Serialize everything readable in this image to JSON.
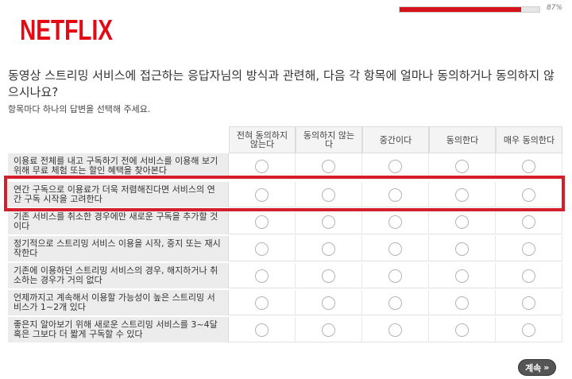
{
  "brand": {
    "logo_text": "NETFLIX",
    "color": "#e50914"
  },
  "progress": {
    "percent_label": "87%",
    "value": 87
  },
  "survey": {
    "question": "동영상 스트리밍 서비스에 접근하는 응답자님의 방식과 관련해, 다음 각 항목에 얼마나 동의하거나 동의하지 않으시나요?",
    "instruction": "항목마다 하나의 답변을 선택해 주세요.",
    "columns": [
      "전혀 동의하지 않는다",
      "동의하지 않는다",
      "중간이다",
      "동의한다",
      "매우 동의한다"
    ],
    "rows": [
      "이용료 전체를 내고 구독하기 전에 서비스를 이용해 보기 위해 무료 체험 또는 할인 혜택을 찾아본다",
      "연간 구독으로 이용료가 더욱 저렴해진다면 서비스의 연간 구독 시작을 고려한다",
      "기존 서비스를 취소한 경우에만 새로운 구독을 추가할 것이다",
      "정기적으로 스트리밍 서비스 이용을 시작, 중지 또는 재시작한다",
      "기존에 이용하던 스트리밍 서비스의 경우, 해지하거나 취소하는 경우가 거의 없다",
      "언제까지고 계속해서 이용할 가능성이 높은 스트리밍 서비스가 1~2개 있다",
      "좋은지 알아보기 위해 새로운 스트리밍 서비스를 3~4달 혹은 그보다 더 짧게 구독할 수 있다"
    ]
  },
  "continue_button": {
    "label": "계속",
    "arrow": "»"
  },
  "highlight_color": "#d31f2b"
}
